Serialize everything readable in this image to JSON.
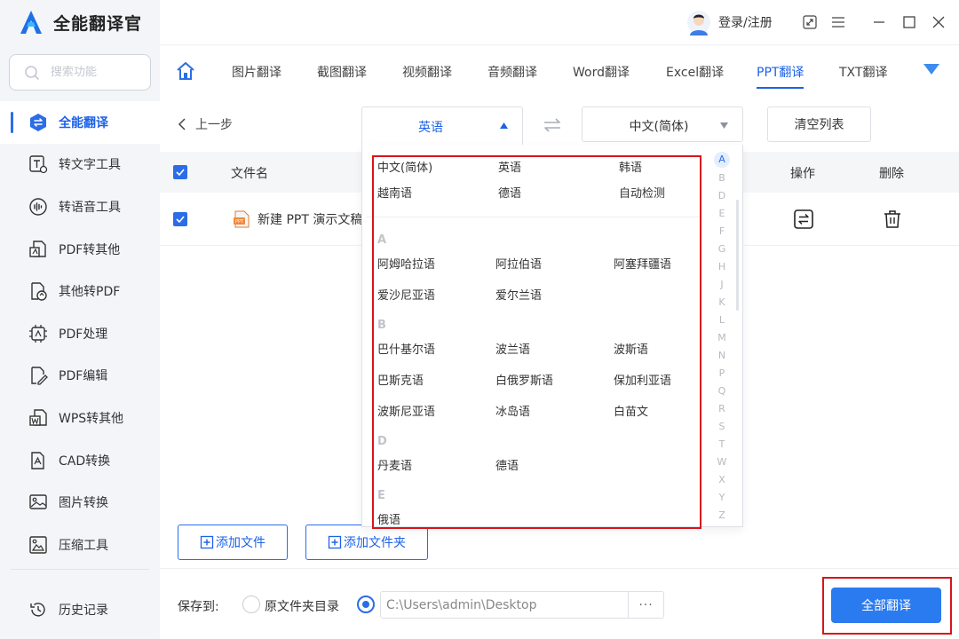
{
  "app": {
    "title": "全能翻译官",
    "accent": "#2b6de8",
    "highlight": "#d9141b"
  },
  "sidebar": {
    "search_placeholder": "搜索功能",
    "items": [
      {
        "label": "全能翻译",
        "icon": "translate-icon",
        "active": true
      },
      {
        "label": "转文字工具",
        "icon": "text-convert-icon"
      },
      {
        "label": "转语音工具",
        "icon": "voice-icon"
      },
      {
        "label": "PDF转其他",
        "icon": "pdf-export-icon"
      },
      {
        "label": "其他转PDF",
        "icon": "pdf-import-icon"
      },
      {
        "label": "PDF处理",
        "icon": "pdf-process-icon"
      },
      {
        "label": "PDF编辑",
        "icon": "pdf-edit-icon"
      },
      {
        "label": "WPS转其他",
        "icon": "wps-icon"
      },
      {
        "label": "CAD转换",
        "icon": "cad-icon"
      },
      {
        "label": "图片转换",
        "icon": "image-convert-icon"
      },
      {
        "label": "压缩工具",
        "icon": "compress-icon"
      }
    ],
    "history_label": "历史记录"
  },
  "titlebar": {
    "login_label": "登录/注册"
  },
  "tabs": [
    {
      "label": "图片翻译"
    },
    {
      "label": "截图翻译"
    },
    {
      "label": "视频翻译"
    },
    {
      "label": "音频翻译"
    },
    {
      "label": "Word翻译"
    },
    {
      "label": "Excel翻译"
    },
    {
      "label": "PPT翻译",
      "active": true
    },
    {
      "label": "TXT翻译"
    }
  ],
  "toolbar": {
    "back_label": "上一步",
    "source_language": "英语",
    "target_language": "中文(简体)",
    "clear_label": "清空列表"
  },
  "table": {
    "headers": {
      "filename": "文件名",
      "operation": "操作",
      "delete": "删除"
    },
    "rows": [
      {
        "filename": "新建 PPT 演示文稿"
      }
    ]
  },
  "language_dropdown": {
    "common": [
      "中文(简体)",
      "英语",
      "韩语",
      "越南语",
      "德语",
      "自动检测"
    ],
    "groups": [
      {
        "letter": "A",
        "languages": [
          "阿姆哈拉语",
          "阿拉伯语",
          "阿塞拜疆语",
          "爱沙尼亚语",
          "爱尔兰语"
        ]
      },
      {
        "letter": "B",
        "languages": [
          "巴什基尔语",
          "波兰语",
          "波斯语",
          "巴斯克语",
          "白俄罗斯语",
          "保加利亚语",
          "波斯尼亚语",
          "冰岛语",
          "白苗文"
        ]
      },
      {
        "letter": "D",
        "languages": [
          "丹麦语",
          "德语"
        ]
      },
      {
        "letter": "E",
        "languages": [
          "俄语"
        ]
      }
    ],
    "alphabet": [
      "A",
      "B",
      "D",
      "E",
      "F",
      "G",
      "H",
      "J",
      "K",
      "L",
      "M",
      "N",
      "P",
      "Q",
      "R",
      "S",
      "T",
      "W",
      "X",
      "Y",
      "Z"
    ],
    "active_letter": "A"
  },
  "actions": {
    "add_file": "添加文件",
    "add_folder": "添加文件夹"
  },
  "footer": {
    "save_to_label": "保存到:",
    "option_source_dir": "原文件夹目录",
    "path_value": "C:\\Users\\admin\\Desktop",
    "path_more": "···",
    "translate_all": "全部翻译"
  }
}
